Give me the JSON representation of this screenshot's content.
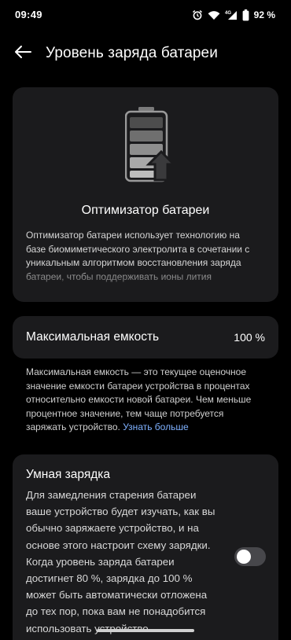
{
  "status_bar": {
    "time": "09:49",
    "battery_percent": "92 %",
    "battery_level": 0.92,
    "icons": [
      "alarm-icon",
      "wifi-icon",
      "signal-4g-icon",
      "battery-icon"
    ]
  },
  "header": {
    "back_icon": "arrow-left-icon",
    "title": "Уровень заряда батареи"
  },
  "optimizer": {
    "icon": "battery-optimizer-icon",
    "title": "Оптимизатор батареи",
    "description": "Оптимизатор батареи использует технологию на базе биомиметического электролита в сочетании с уникальным алгоритмом восстановления заряда батареи, чтобы поддерживать ионы лития"
  },
  "capacity": {
    "label": "Максимальная емкость",
    "value": "100 %",
    "description": "Максимальная емкость — это текущее оценочное значение емкости батареи устройства в процентах относительно емкости новой батареи. Чем меньше процентное значение, тем чаще потребуется заряжать устройство.",
    "learn_more": "Узнать больше"
  },
  "smart_charging": {
    "title": "Умная зарядка",
    "description": "Для замедления старения батареи ваше устройство будет изучать, как вы обычно заряжаете устройство, и на основе этого настроит схему зарядки. Когда уровень заряда батареи достигнет 80 %, зарядка до 100 % может быть автоматически отложена до тех пор, пока вам не понадобится использовать устройство.",
    "enabled": false
  },
  "colors": {
    "background": "#000000",
    "card": "#1b1b1d",
    "link": "#7fb1ff",
    "toggle_off": "#47474b"
  }
}
